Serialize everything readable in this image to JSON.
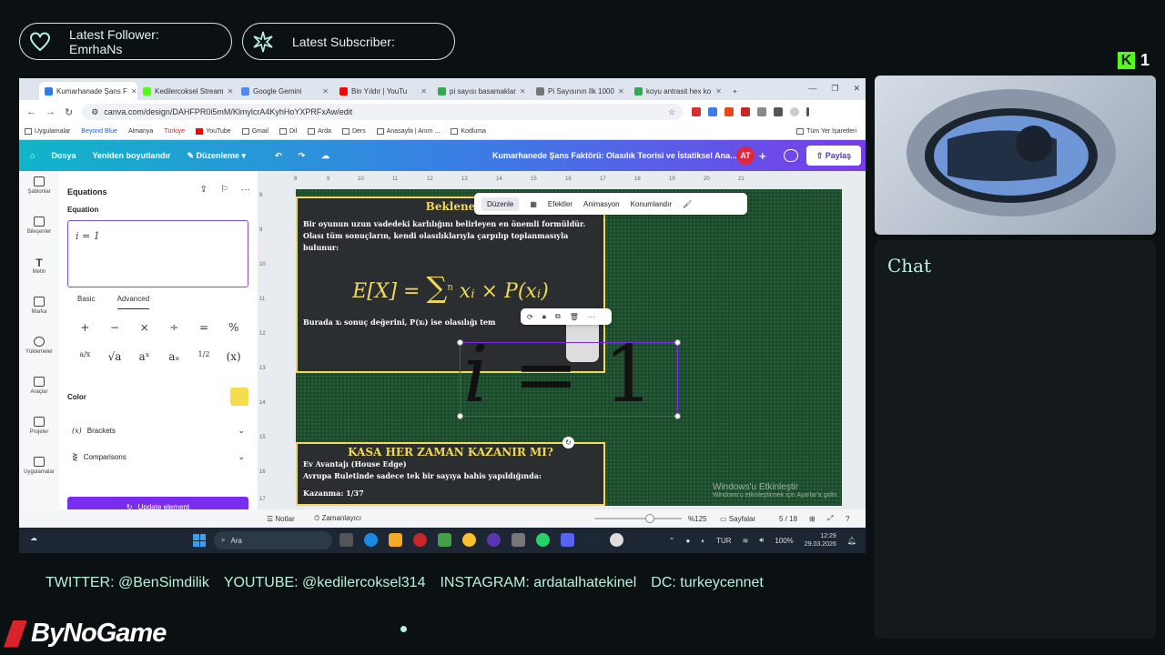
{
  "overlay": {
    "follower_label": "Latest Follower:",
    "follower_name": "EmrhaNs",
    "subscriber_label": "Latest Subscriber:",
    "subscriber_name": "",
    "kick_count": "1",
    "chat_title": "Chat",
    "socials": [
      "TWITTER: @BenSimdilik",
      "YOUTUBE: @kedilercoksel314",
      "INSTAGRAM: ardatalhatekinel",
      "DC: turkeycennet"
    ],
    "brand": "ByNoGame"
  },
  "browser": {
    "tabs": [
      {
        "title": "Kumarhanade Şans F",
        "color": "#2b7de9"
      },
      {
        "title": "Kedilercoksel Stream",
        "color": "#53fc18"
      },
      {
        "title": "Google Gemini",
        "color": "#4b8cf7"
      },
      {
        "title": "Bin Yıldır | YouTu",
        "color": "#ff0000"
      },
      {
        "title": "pi sayısı basamaklar",
        "color": "#34a853"
      },
      {
        "title": "Pi Sayısının İlk 1000",
        "color": "#777777"
      },
      {
        "title": "koyu antrasit hex ko",
        "color": "#34a853"
      }
    ],
    "url": "canva.com/design/DAHFPR0i5mM/KlmylcrA4KyhHoYXPRFxAw/edit",
    "bookmarks": [
      "Uygulamalar",
      "Beyond Blue",
      "Almanya",
      "Türkiye",
      "YouTube",
      "Gmail",
      "Dil",
      "Arda",
      "Ders",
      "Anasayfa | Anım ...",
      "Kodluma"
    ],
    "bookmarks_last": "Tüm Yer İşaretleri"
  },
  "canva": {
    "menu": [
      "Dosya",
      "Yeniden boyutlandır",
      "Düzenleme"
    ],
    "doc_title": "Kumarhanede Şans Faktörü: Olasılık Teorisi ve İstatiksel Ana...",
    "avatar": "AT",
    "share": "Paylaş",
    "rail": [
      "Şablonlar",
      "Bileşenler",
      "Metin",
      "Marka",
      "Yüklemeler",
      "Araçlar",
      "Projeler",
      "Uygulamalar"
    ],
    "panel": {
      "title": "Equations",
      "equation_label": "Equation",
      "equation_value": "i = 1",
      "tab_basic": "Basic",
      "tab_advanced": "Advanced",
      "ops": [
        "+",
        "−",
        "×",
        "÷",
        "=",
        "%",
        "a/x",
        "√a",
        "aˣ",
        "aₓ",
        "1/2",
        "(x)"
      ],
      "color_label": "Color",
      "color_value": "#f5dd4e",
      "brackets": "Brackets",
      "comparisons": "Comparisons",
      "update_button": "Update element"
    },
    "float_toolbar": [
      "Düzenle",
      "Efektler",
      "Animasyon",
      "Konumlandır"
    ],
    "slide": {
      "heading": "Beklene",
      "body": "Bir oyunun uzun vadedeki karlılığını belirleyen en önemli formüldür. Olası tüm sonuçların, kendi olasılıklarıyla çarpılıp toplanmasıyla bulunur:",
      "formula_left": "E[X] =",
      "formula_top": "n",
      "formula_right": "xᵢ × P(xᵢ)",
      "note": "Burada xᵢ sonuç değerini, P(xᵢ) ise olasılığı tem",
      "big_equation_i": "i",
      "big_equation_rest": " = 1",
      "bottom_heading": "KASA HER ZAMAN KAZANIR MI?",
      "bottom_line1": "Ev Avantajı (House Edge)",
      "bottom_line2": "Avrupa Ruletinde sadece tek bir sayıya bahis yapıldığında:",
      "bottom_line3": "Kazanma: 1/37"
    },
    "watermark_1": "Windows'u Etkinleştir",
    "watermark_2": "Windows'u etkinleştirmek için Ayarlar'a gidin.",
    "footer": {
      "notes": "Notlar",
      "timer": "Zamanlayıcı",
      "zoom": "%125",
      "pages": "Sayfalar",
      "page_count": "5 / 18"
    }
  },
  "taskbar": {
    "search": "Ara",
    "lang": "TUR",
    "battery": "100%",
    "time": "12:29",
    "date": "29.03.2026"
  }
}
